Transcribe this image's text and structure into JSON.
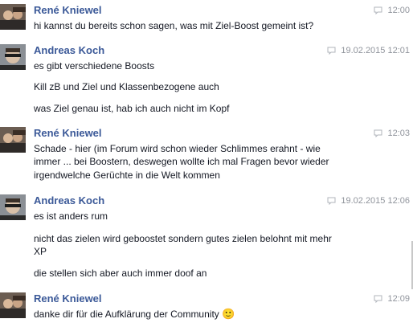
{
  "messages": [
    {
      "author": "René Kniewel",
      "time": "12:00",
      "lines": [
        "hi kannst du bereits schon sagen, was mit Ziel-Boost gemeint ist?"
      ]
    },
    {
      "author": "Andreas Koch",
      "time": "19.02.2015 12:01",
      "lines": [
        "es gibt verschiedene Boosts",
        "Kill zB und Ziel und Klassenbezogene auch",
        "was Ziel genau ist, hab ich auch nicht  im Kopf"
      ]
    },
    {
      "author": "René Kniewel",
      "time": "12:03",
      "lines": [
        "Schade - hier (im Forum wird schon wieder Schlimmes erahnt - wie",
        "immer ... bei Boostern, deswegen wollte ich mal Fragen bevor wieder",
        "irgendwelche Gerüchte in die Welt kommen"
      ]
    },
    {
      "author": "Andreas Koch",
      "time": "19.02.2015 12:06",
      "lines": [
        "es ist anders rum",
        "nicht das zielen wird geboostet sondern gutes zielen belohnt mit mehr",
        "XP",
        "die stellen sich aber auch immer doof an"
      ]
    },
    {
      "author": "René Kniewel",
      "time": "12:09",
      "lines": [
        "danke dir für die Aufklärung der Community"
      ],
      "emoji": "🙂"
    }
  ]
}
